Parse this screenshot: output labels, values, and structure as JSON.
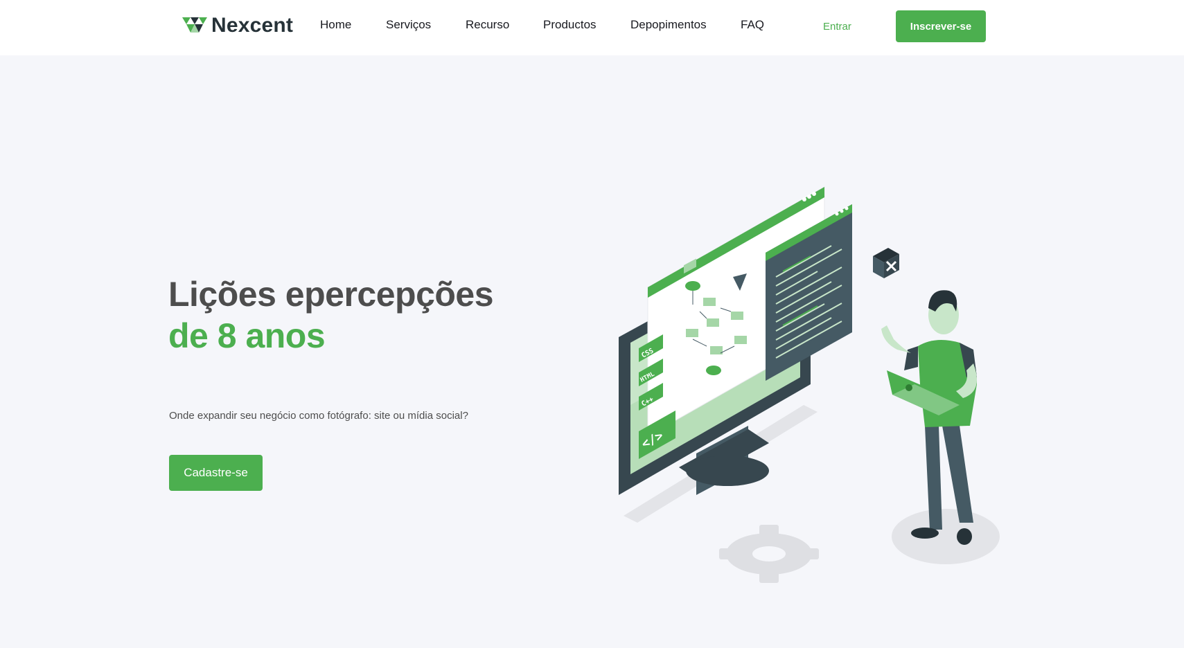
{
  "brand": {
    "name": "Nexcent",
    "logo_icon": "triangles-logo-icon"
  },
  "nav": {
    "items": [
      {
        "label": "Home"
      },
      {
        "label": "Serviços"
      },
      {
        "label": "Recurso"
      },
      {
        "label": "Productos"
      },
      {
        "label": "Depopimentos"
      },
      {
        "label": "FAQ"
      }
    ],
    "login_label": "Entrar",
    "signup_label": "Inscrever-se"
  },
  "hero": {
    "title_part1": "Lições epercepções",
    "title_accent": "de 8 anos",
    "subtitle": "Onde expandir seu negócio como fotógrafo: site ou mídia social?",
    "cta_label": "Cadastre-se"
  },
  "illustration": {
    "badges": [
      "CSS",
      "HTML",
      "C++",
      "</>"
    ],
    "code_tag": "</> ..."
  },
  "colors": {
    "primary": "#4caf4f",
    "primary_light": "#a5d6a7",
    "dark": "#263238",
    "slate": "#455a64",
    "text": "#4d4d4d",
    "background": "#f5f6fa"
  }
}
